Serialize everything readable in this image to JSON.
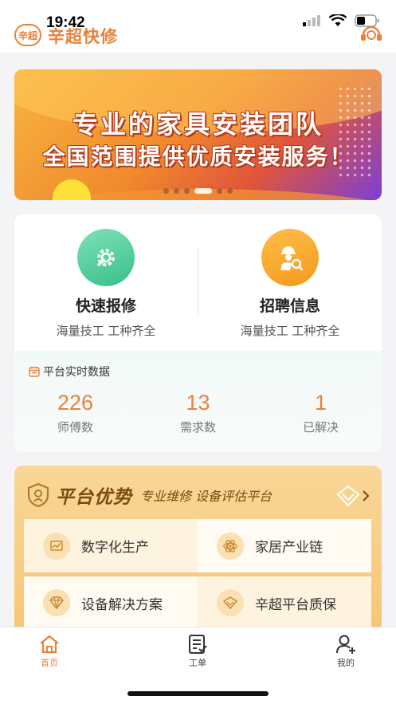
{
  "status_bar": {
    "time": "19:42"
  },
  "header": {
    "logo_text": "辛超",
    "app_name": "辛超快修"
  },
  "banner": {
    "line1": "专业的家具安装团队",
    "line2": "全国范围提供优质安装服务！",
    "slide_count": 6,
    "active_slide": 4
  },
  "services": [
    {
      "title": "快速报修",
      "subtitle": "海量技工 工种齐全",
      "icon": "wrench-gear-icon"
    },
    {
      "title": "招聘信息",
      "subtitle": "海量技工 工种齐全",
      "icon": "worker-search-icon"
    }
  ],
  "stats": {
    "title": "平台实时数据",
    "items": [
      {
        "value": "226",
        "label": "师傅数"
      },
      {
        "value": "13",
        "label": "需求数"
      },
      {
        "value": "1",
        "label": "已解决"
      }
    ]
  },
  "advantages": {
    "title": "平台优势",
    "subtitle": "专业维修 设备评估平台",
    "items": [
      {
        "label": "数字化生产",
        "icon": "chart-icon"
      },
      {
        "label": "家居产业链",
        "icon": "atom-icon"
      },
      {
        "label": "设备解决方案",
        "icon": "diamond-icon"
      },
      {
        "label": "辛超平台质保",
        "icon": "gem-shield-icon"
      }
    ]
  },
  "tabbar": {
    "tabs": [
      {
        "label": "首页",
        "icon": "home-icon",
        "active": true
      },
      {
        "label": "工单",
        "icon": "order-list-icon",
        "active": false
      },
      {
        "label": "我的",
        "icon": "user-add-icon",
        "active": false
      }
    ]
  },
  "colors": {
    "accent": "#e8823a",
    "green": "#37c089",
    "gold": "#f6c676"
  }
}
